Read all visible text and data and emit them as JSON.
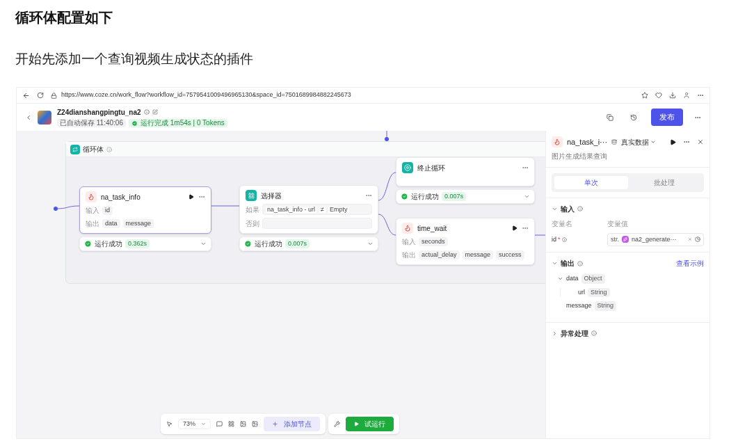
{
  "article": {
    "heading": "循环体配置如下",
    "paragraph": "开始先添加一个查询视频生成状态的插件"
  },
  "browser": {
    "url": "https://www.coze.cn/work_flow?workflow_id=7579541009496965130&space_id=7501689984882245673"
  },
  "app_header": {
    "title": "Z24dianshangpingtu_na2",
    "saved": "已自动保存 11:40:06",
    "run_status": "运行完成 1m54s | 0 Tokens",
    "publish": "发布"
  },
  "loop": {
    "title": "循环体"
  },
  "nodes": [
    {
      "kind": "plugin",
      "title": "na_task_info",
      "rows": [
        {
          "label": "输入",
          "params": [
            "id"
          ]
        },
        {
          "label": "输出",
          "params": [
            "data",
            "message"
          ]
        }
      ],
      "status": "运行成功",
      "time": "0.362s",
      "selected": true
    },
    {
      "kind": "selector",
      "title": "选择器",
      "rows": [
        {
          "label": "如果",
          "params": [
            "na_task_info - url",
            "≠",
            "Empty"
          ]
        },
        {
          "label": "否则",
          "params": []
        }
      ],
      "status": "运行成功",
      "time": "0.007s",
      "selected": false
    },
    {
      "kind": "stop",
      "title": "终止循环",
      "status": "运行成功",
      "time": "0.007s",
      "selected": false
    },
    {
      "kind": "plugin",
      "title": "time_wait",
      "rows": [
        {
          "label": "输入",
          "params": [
            "seconds"
          ]
        },
        {
          "label": "输出",
          "params": [
            "actual_delay",
            "message",
            "success"
          ]
        }
      ],
      "selected": false
    }
  ],
  "panel": {
    "title": "na_task_i···",
    "data_mode": "真实数据",
    "description": "图片生成结果查询",
    "tabs": [
      {
        "label": "单次",
        "selected": true
      },
      {
        "label": "批处理",
        "selected": false
      }
    ],
    "input": {
      "title": "输入",
      "expanded": true,
      "col_name": "变量名",
      "col_value": "变量值",
      "param": "id",
      "required_mark": "*",
      "type": "str.",
      "value": "na2_generate···"
    },
    "output": {
      "title": "输出",
      "expanded": true,
      "link": "查看示例",
      "fields": [
        {
          "name": "data",
          "type": "Object",
          "expanded": true,
          "children": [
            {
              "name": "url",
              "type": "String"
            }
          ]
        },
        {
          "name": "message",
          "type": "String"
        }
      ]
    },
    "error": {
      "title": "异常处理",
      "expanded": false
    }
  },
  "toolbar": {
    "zoom": "73%",
    "add_node": "添加节点",
    "test_run": "试运行"
  }
}
